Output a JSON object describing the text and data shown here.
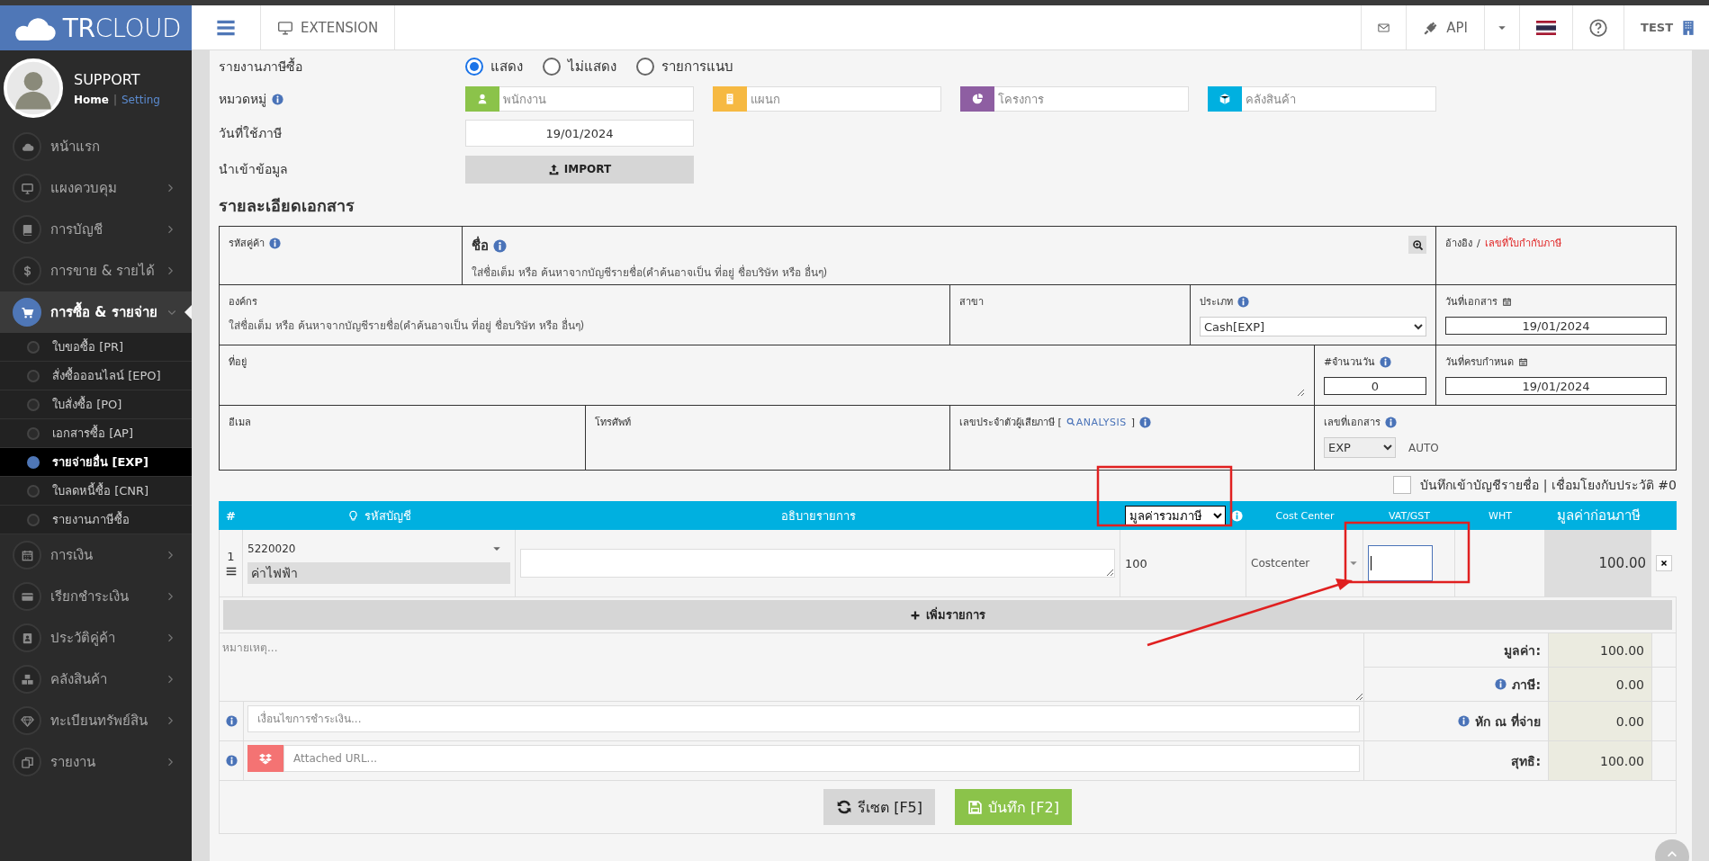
{
  "sidebar": {
    "logo": "**TR**CLOUD",
    "profile": {
      "name": "SUPPORT",
      "separator": "|",
      "links": [
        {
          "label": "Home",
          "kind": "current"
        },
        {
          "label": "Setting",
          "kind": "link"
        }
      ]
    },
    "items": [
      {
        "label": "หน้าแรก",
        "has_submenu": false,
        "selected": false,
        "expanded": false
      },
      {
        "label": "แผงควบคุม",
        "has_submenu": true,
        "selected": false,
        "expanded": false
      },
      {
        "label": "การบัญชี",
        "has_submenu": true,
        "selected": false,
        "expanded": false
      },
      {
        "label": "การขาย & รายได้",
        "has_submenu": true,
        "selected": false,
        "expanded": false
      },
      {
        "label": "การซื้อ & รายจ่าย",
        "has_submenu": true,
        "selected": true,
        "expanded": true,
        "children": [
          {
            "label": "ใบขอซื้อ [PR]",
            "selected": false
          },
          {
            "label": "สั่งซื้อออนไลน์ [EPO]",
            "selected": false
          },
          {
            "label": "ใบสั่งซื้อ [PO]",
            "selected": false
          },
          {
            "label": "เอกสารซื้อ [AP]",
            "selected": false
          },
          {
            "label": "รายจ่ายอื่น [EXP]",
            "selected": true
          },
          {
            "label": "ใบลดหนี้ซื้อ [CNR]",
            "selected": false
          },
          {
            "label": "รายงานภาษีซื้อ",
            "selected": false
          }
        ]
      },
      {
        "label": "การเงิน",
        "has_submenu": true,
        "selected": false,
        "expanded": false
      },
      {
        "label": "เรียกชำระเงิน",
        "has_submenu": true,
        "selected": false,
        "expanded": false
      },
      {
        "label": "ประวัติคู่ค้า",
        "has_submenu": true,
        "selected": false,
        "expanded": false
      },
      {
        "label": "คลังสินค้า",
        "has_submenu": true,
        "selected": false,
        "expanded": false
      },
      {
        "label": "ทะเบียนทรัพย์สิน",
        "has_submenu": true,
        "selected": false,
        "expanded": false
      },
      {
        "label": "รายงาน",
        "has_submenu": true,
        "selected": false,
        "expanded": false
      }
    ]
  },
  "header": {
    "tab": "EXTENSION",
    "api": "API",
    "user": "TEST"
  },
  "tax_report": {
    "label": "รายงานภาษีซื้อ",
    "options": [
      {
        "label": "แสดง",
        "selected": true
      },
      {
        "label": "ไม่แสดง",
        "selected": false
      },
      {
        "label": "รายการแนบ",
        "selected": false
      }
    ]
  },
  "category": {
    "label": "หมวดหมู่",
    "fields": [
      {
        "placeholder": "พนักงาน",
        "color": "#8bc34a"
      },
      {
        "placeholder": "แผนก",
        "color": "#f6b942"
      },
      {
        "placeholder": "โครงการ",
        "color": "#8e5ea2"
      },
      {
        "placeholder": "คลังสินค้า",
        "color": "#00b0e0"
      }
    ]
  },
  "tax_date": {
    "label": "วันที่ใช้ภาษี",
    "value": "19/01/2024"
  },
  "import": {
    "label": "นำเข้าข้อมูล",
    "button": "IMPORT"
  },
  "document": {
    "title": "รายละเอียดเอกสาร",
    "vendor_code": {
      "label": "รหัสคู่ค้า"
    },
    "name": {
      "label": "ชื่อ",
      "placeholder": "ใส่ชื่อเต็ม หรือ ค้นหาจากบัญชีรายชื่อ(คำค้นอาจเป็น ที่อยู่ ชื่อบริษัท หรือ อื่นๆ)"
    },
    "reference": {
      "label": "อ้างอิง",
      "separator": "/",
      "link": "เลขที่ใบกำกับภาษี"
    },
    "organization": {
      "label": "องค์กร",
      "placeholder": "ใส่ชื่อเต็ม หรือ ค้นหาจากบัญชีรายชื่อ(คำค้นอาจเป็น ที่อยู่ ชื่อบริษัท หรือ อื่นๆ)"
    },
    "branch": {
      "label": "สาขา"
    },
    "type": {
      "label": "ประเภท",
      "value": "Cash[EXP]"
    },
    "doc_date": {
      "label": "วันที่เอกสาร",
      "value": "19/01/2024"
    },
    "address": {
      "label": "ที่อยู่"
    },
    "days": {
      "label": "#จำนวนวัน",
      "value": "0"
    },
    "due_date": {
      "label": "วันที่ครบกำหนด",
      "value": "19/01/2024"
    },
    "email": {
      "label": "อีเมล"
    },
    "phone": {
      "label": "โทรศัพท์"
    },
    "tax_id": {
      "label_before": "เลขประจำตัวผู้เสียภาษี [",
      "link": "ANALYSIS",
      "label_after": "]"
    },
    "doc_no": {
      "label": "เลขที่เอกสาร",
      "value": "EXP",
      "note": "AUTO"
    }
  },
  "ledger": {
    "label": "บันทึกเข้าบัญชีรายชื่อ | เชื่อมโยงกับประวัติ #0",
    "checked": false
  },
  "items": {
    "columns": [
      {
        "label": "#",
        "kind": "text"
      },
      {
        "label": "รหัสบัญชี",
        "kind": "hint"
      },
      {
        "label": "อธิบายรายการ",
        "kind": "text"
      },
      {
        "label": "มูลค่ารวมภาษี",
        "kind": "select"
      },
      {
        "label": "Cost Center",
        "kind": "small"
      },
      {
        "label": "VAT/GST",
        "kind": "small"
      },
      {
        "label": "WHT",
        "kind": "small"
      },
      {
        "label": "มูลค่าก่อนภาษี",
        "kind": "large"
      }
    ],
    "rows": [
      {
        "number": "1",
        "account_code": "5220020",
        "account_name": "ค่าไฟฟ้า",
        "quantity": "100",
        "cost_center": "Costcenter",
        "vat_focused": true,
        "amount": "100.00"
      }
    ],
    "add_button": "เพิ่มรายการ"
  },
  "notes": {
    "placeholder": "หมายเหตุ..."
  },
  "payment_terms": {
    "placeholder": "เงื่อนไขการชำระเงิน..."
  },
  "attachment": {
    "placeholder": "Attached URL..."
  },
  "summary": [
    {
      "label": "มูลค่า:",
      "value": "100.00",
      "info": false
    },
    {
      "label": "ภาษี:",
      "value": "0.00",
      "info": true
    },
    {
      "label": "หัก ณ ที่จ่าย",
      "value": "0.00",
      "info": true
    },
    {
      "label": "สุทธิ:",
      "value": "100.00",
      "info": false
    }
  ],
  "buttons": [
    {
      "label": "รีเซต [F5]",
      "kind": "reset"
    },
    {
      "label": "บันทึก [F2]",
      "kind": "save"
    }
  ],
  "annotations": [
    {
      "kind": "box"
    },
    {
      "kind": "box"
    },
    {
      "kind": "arrow"
    }
  ]
}
